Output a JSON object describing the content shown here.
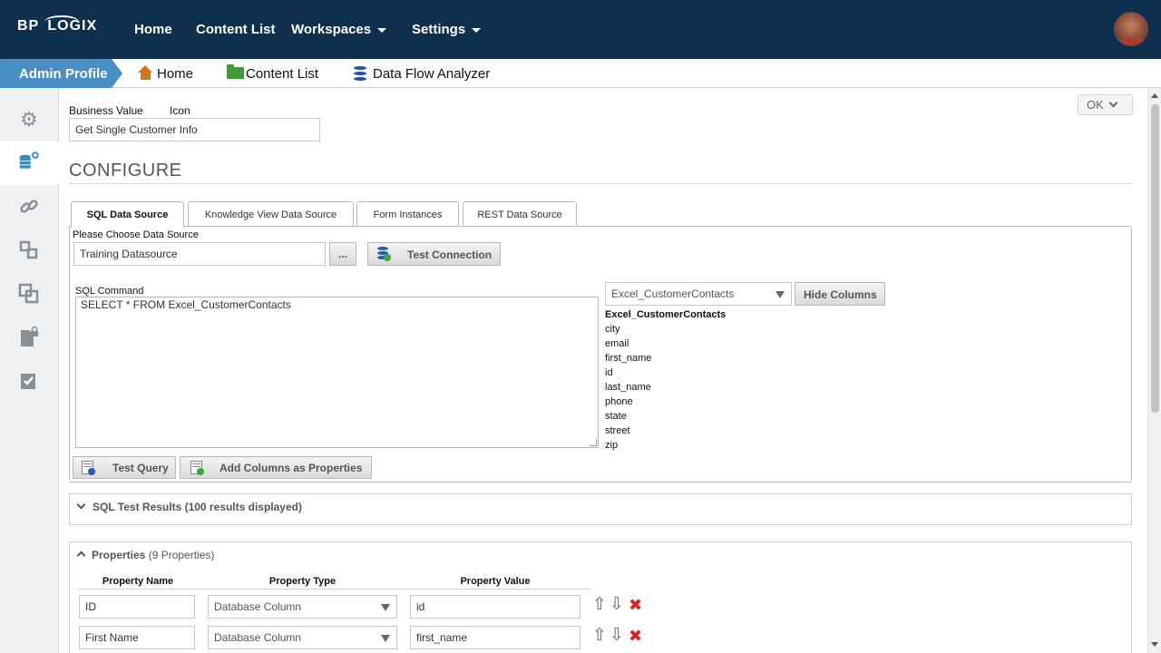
{
  "app": {
    "logo_left": "BP",
    "logo_right": "LOGIX",
    "nav": [
      {
        "label": "Home"
      },
      {
        "label": "Content List"
      },
      {
        "label": "Workspaces"
      },
      {
        "label": "Settings"
      }
    ]
  },
  "breadcrumb": {
    "admin": "Admin Profile",
    "home": "Home",
    "content_list": "Content List",
    "data_flow": "Data Flow Analyzer"
  },
  "sidebar": {
    "icons": [
      "gear-icon",
      "database-add-icon",
      "link-icon",
      "sitemap-icon",
      "copy-icon",
      "locked-document-icon",
      "checklist-icon"
    ]
  },
  "header": {
    "ok_label": "OK",
    "business_value_label": "Business Value",
    "icon_label": "Icon",
    "business_value": "Get Single Customer Info",
    "section_title": "CONFIGURE"
  },
  "tabs": [
    {
      "label": "SQL Data Source",
      "active": true
    },
    {
      "label": "Knowledge View Data Source",
      "active": false
    },
    {
      "label": "Form Instances",
      "active": false
    },
    {
      "label": "REST Data Source",
      "active": false
    }
  ],
  "sql": {
    "choose_label": "Please Choose Data Source",
    "datasource": "Training Datasource",
    "browse_label": "...",
    "test_connection": "Test Connection",
    "command_label": "SQL Command",
    "command": "SELECT * FROM Excel_CustomerContacts",
    "table_select": "Excel_CustomerContacts",
    "hide_columns": "Hide Columns",
    "table_name": "Excel_CustomerContacts",
    "columns": [
      "city",
      "email",
      "first_name",
      "id",
      "last_name",
      "phone",
      "state",
      "street",
      "zip"
    ],
    "test_query": "Test Query",
    "add_columns": "Add Columns as Properties"
  },
  "test_results": {
    "label": "SQL Test Results (100 results displayed)"
  },
  "properties": {
    "title": "Properties",
    "count": "(9 Properties)",
    "headers": {
      "name": "Property Name",
      "type": "Property Type",
      "value": "Property Value"
    },
    "rows": [
      {
        "name": "ID",
        "type": "Database Column",
        "value": "id"
      },
      {
        "name": "First Name",
        "type": "Database Column",
        "value": "first_name"
      }
    ]
  },
  "colors": {
    "topbar": "#0f2f4f",
    "admin_tab": "#4a8ec6",
    "delete": "#e01e1e"
  }
}
